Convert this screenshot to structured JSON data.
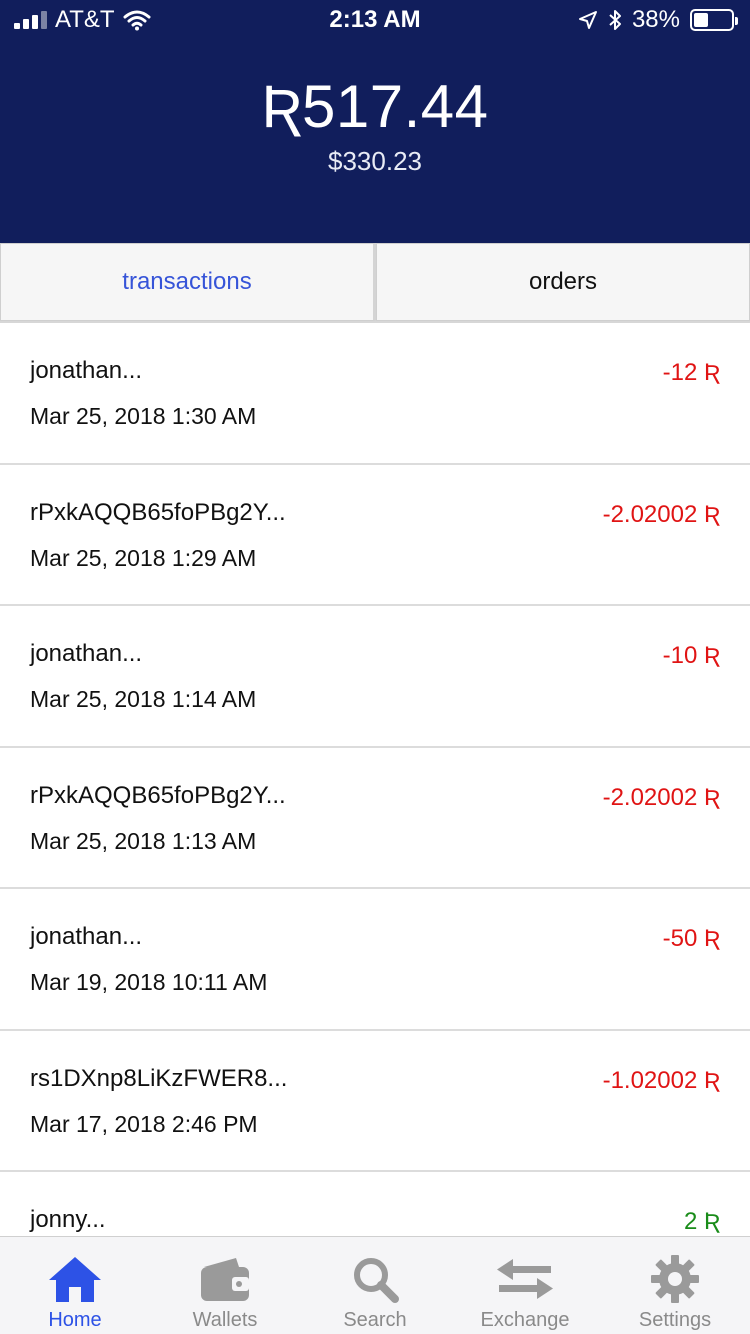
{
  "status_bar": {
    "carrier": "AT&T",
    "time": "2:13 AM",
    "battery_percent": "38%",
    "battery_level": 0.38,
    "signal_bars_filled": 3
  },
  "header": {
    "balance": "Ʀ517.44",
    "balance_usd": "$330.23",
    "background_color": "#111e5c"
  },
  "tabs": [
    {
      "label": "transactions",
      "active": true
    },
    {
      "label": "orders",
      "active": false
    }
  ],
  "transactions": [
    {
      "name": "jonathan...",
      "date": "Mar 25, 2018 1:30 AM",
      "amount": "-12 Ʀ",
      "direction": "out"
    },
    {
      "name": "rPxkAQQB65foPBg2Y...",
      "date": "Mar 25, 2018 1:29 AM",
      "amount": "-2.02002 Ʀ",
      "direction": "out"
    },
    {
      "name": "jonathan...",
      "date": "Mar 25, 2018 1:14 AM",
      "amount": "-10 Ʀ",
      "direction": "out"
    },
    {
      "name": "rPxkAQQB65foPBg2Y...",
      "date": "Mar 25, 2018 1:13 AM",
      "amount": "-2.02002 Ʀ",
      "direction": "out"
    },
    {
      "name": "jonathan...",
      "date": "Mar 19, 2018 10:11 AM",
      "amount": "-50 Ʀ",
      "direction": "out"
    },
    {
      "name": "rs1DXnp8LiKzFWER8...",
      "date": "Mar 17, 2018 2:46 PM",
      "amount": "-1.02002 Ʀ",
      "direction": "out"
    },
    {
      "name": "jonny...",
      "date": "",
      "amount": "2 Ʀ",
      "direction": "in"
    }
  ],
  "bottom_nav": [
    {
      "label": "Home",
      "icon": "home-icon",
      "active": true
    },
    {
      "label": "Wallets",
      "icon": "wallet-icon",
      "active": false
    },
    {
      "label": "Search",
      "icon": "search-icon",
      "active": false
    },
    {
      "label": "Exchange",
      "icon": "exchange-icon",
      "active": false
    },
    {
      "label": "Settings",
      "icon": "gear-icon",
      "active": false
    }
  ],
  "colors": {
    "accent": "#2d52e6",
    "negative": "#e01414",
    "positive": "#1a8c1a",
    "inactive": "#8a8a8a"
  }
}
